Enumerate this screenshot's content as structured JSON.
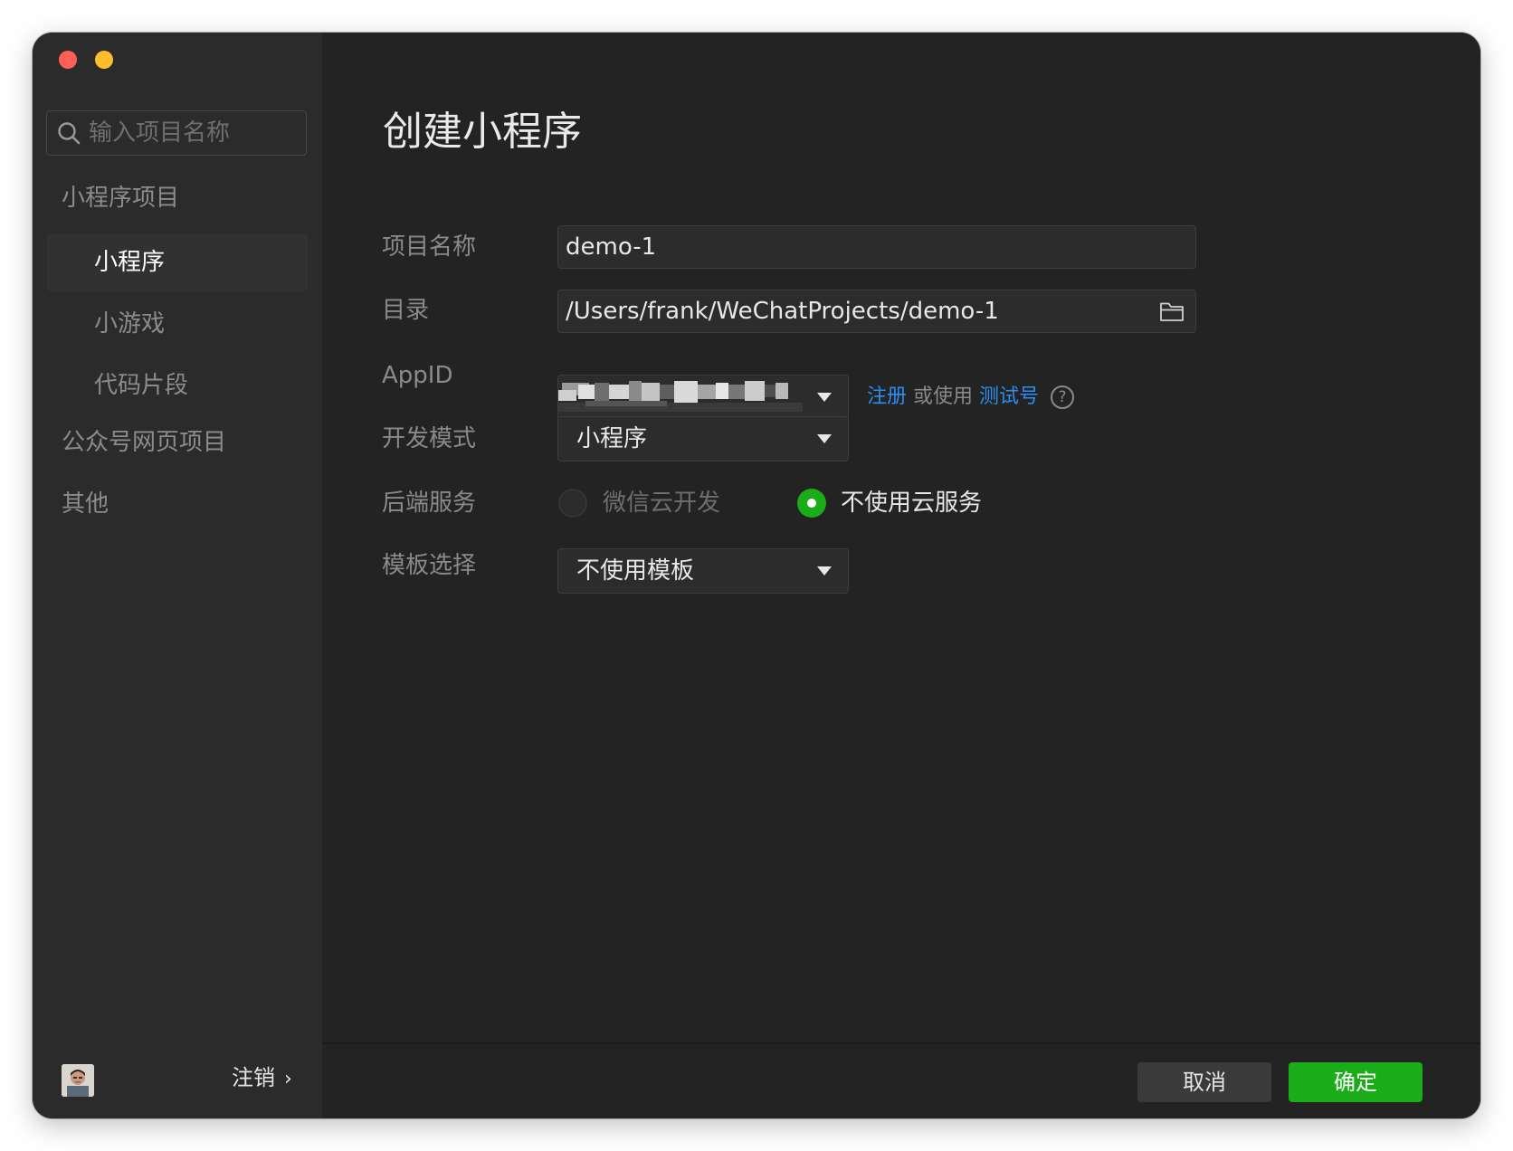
{
  "window": {
    "traffic_lights": [
      "close",
      "minimize"
    ]
  },
  "sidebar": {
    "search_placeholder": "输入项目名称",
    "group_mini": "小程序项目",
    "items": [
      {
        "label": "小程序",
        "active": true
      },
      {
        "label": "小游戏",
        "active": false
      },
      {
        "label": "代码片段",
        "active": false
      }
    ],
    "group_official": "公众号网页项目",
    "group_other": "其他",
    "logout_label": "注销",
    "logout_chevron": "›"
  },
  "main": {
    "title": "创建小程序",
    "labels": {
      "project_name": "项目名称",
      "directory": "目录",
      "appid": "AppID",
      "dev_mode": "开发模式",
      "backend": "后端服务",
      "template": "模板选择"
    },
    "project_name_value": "demo-1",
    "directory_value": "/Users/frank/WeChatProjects/demo-1",
    "appid_links": {
      "register": "注册",
      "or_use": "或使用",
      "test_account": "测试号",
      "help": "?"
    },
    "dev_mode_value": "小程序",
    "backend_options": [
      {
        "label": "微信云开发",
        "selected": false
      },
      {
        "label": "不使用云服务",
        "selected": true
      }
    ],
    "template_value": "不使用模板"
  },
  "footer": {
    "cancel_label": "取消",
    "ok_label": "确定"
  },
  "colors": {
    "accent_green": "#1aad19",
    "link_blue": "#2b8ef0",
    "window_bg": "#232323",
    "sidebar_bg": "#2b2b2b"
  }
}
